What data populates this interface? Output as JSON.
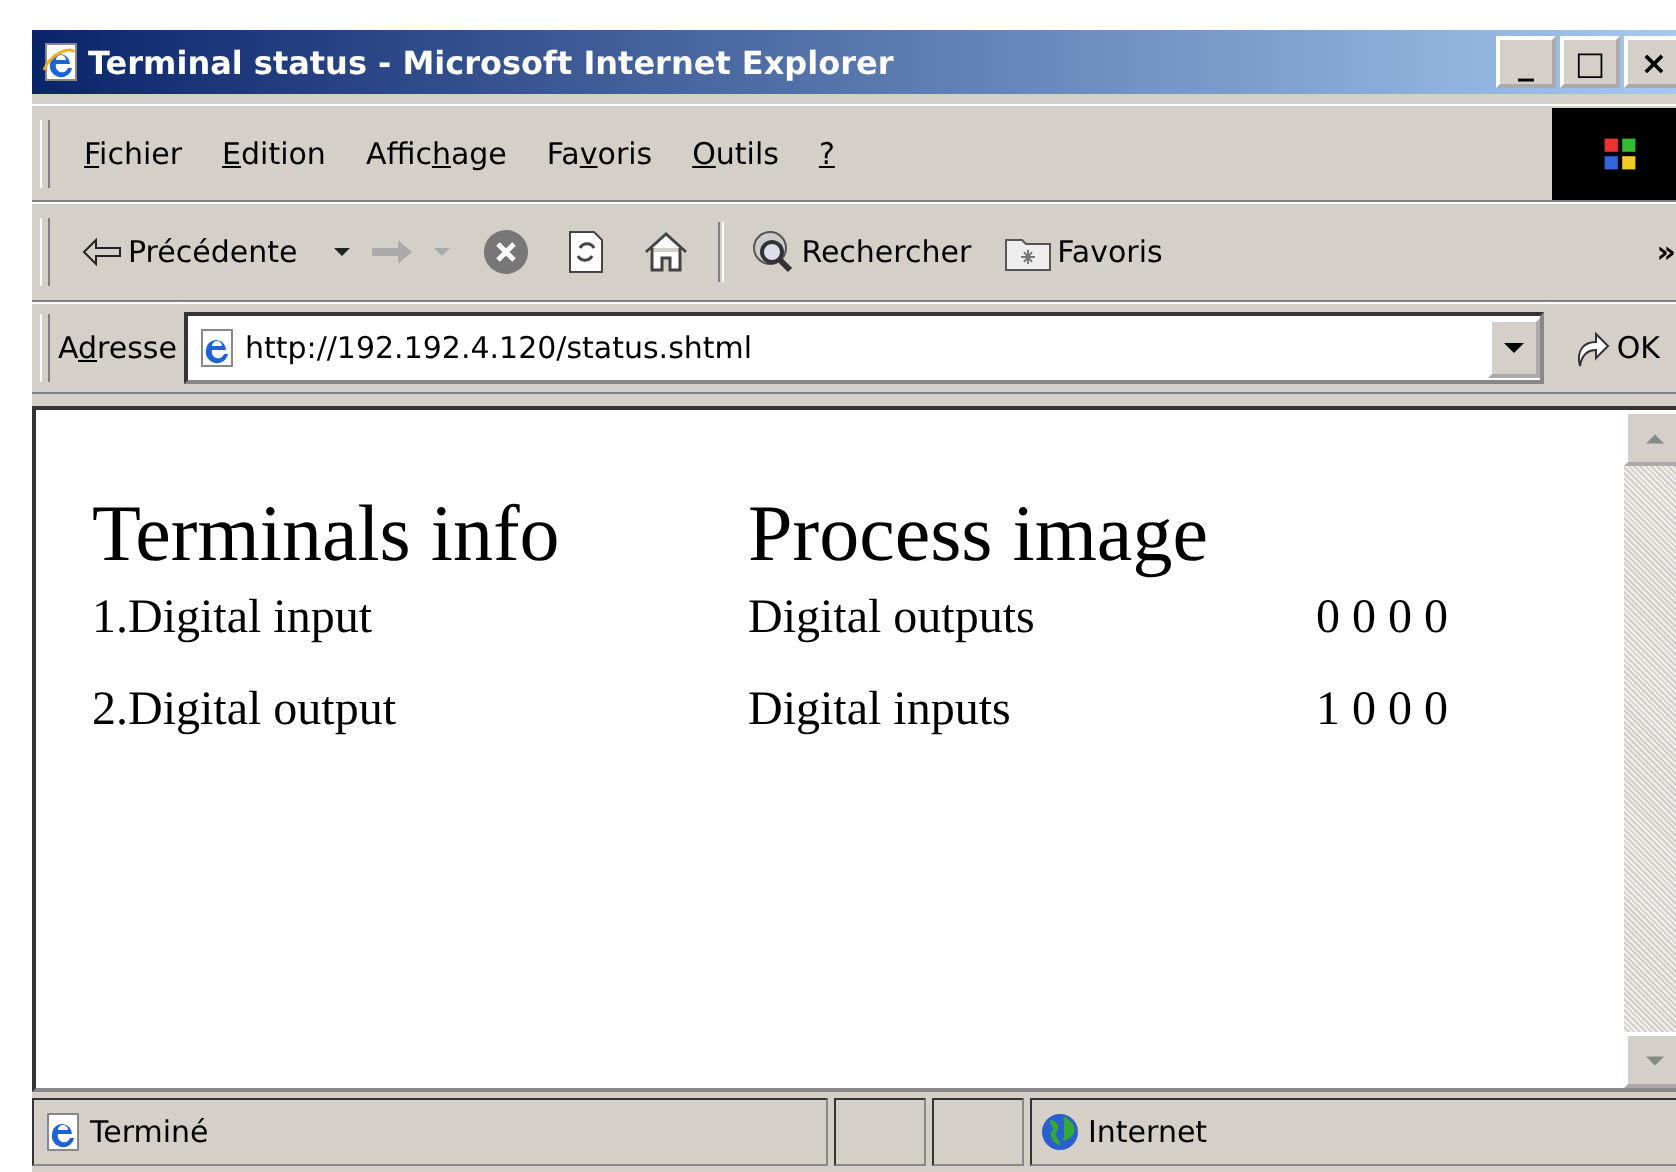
{
  "window": {
    "title": "Terminal status - Microsoft Internet Explorer",
    "controls": [
      "_",
      "□",
      "×"
    ]
  },
  "menu": [
    {
      "key": "F",
      "post": "ichier"
    },
    {
      "key": "E",
      "post": "dition"
    },
    {
      "pre": "Affic",
      "key": "h",
      "post": "age"
    },
    {
      "pre": "Fa",
      "key": "v",
      "post": "oris"
    },
    {
      "key": "O",
      "post": "utils"
    },
    {
      "key": "?"
    }
  ],
  "toolbar": {
    "back": "Précédente",
    "search": "Rechercher",
    "favorites": "Favoris",
    "more": "»"
  },
  "address": {
    "label_pre": "A",
    "label_key": "d",
    "label_post": "resse",
    "value": "http://192.192.4.120/status.shtml",
    "go": "OK"
  },
  "page": {
    "left_heading": "Terminals info",
    "right_heading": "Process image",
    "terminals": [
      "1.Digital input",
      "2.Digital output"
    ],
    "process": [
      {
        "name": "Digital outputs",
        "value": "0 0 0 0"
      },
      {
        "name": "Digital inputs",
        "value": "1 0 0 0"
      }
    ]
  },
  "status_bar": {
    "text": "Terminé",
    "zone": "Internet"
  }
}
